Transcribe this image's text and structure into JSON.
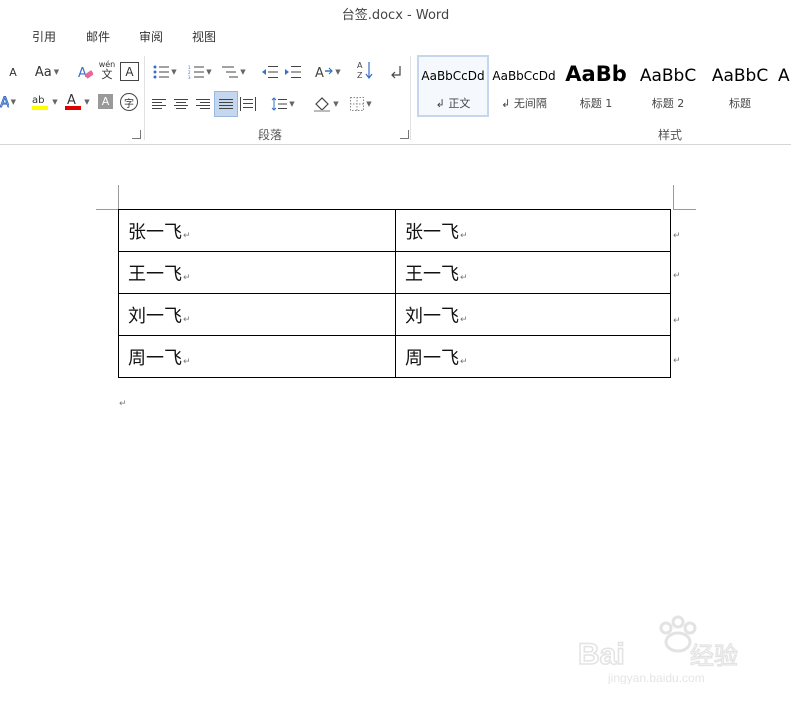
{
  "window": {
    "title": "台签.docx - Word"
  },
  "tabs": [
    {
      "label": "引用"
    },
    {
      "label": "邮件"
    },
    {
      "label": "审阅"
    },
    {
      "label": "视图"
    }
  ],
  "ribbon": {
    "partial_tab": "　",
    "groups": {
      "paragraph": "段落",
      "styles": "样式"
    },
    "font_controls": {
      "grow": "A",
      "case": "Aa",
      "phonetic_top": "wén",
      "phonetic_bottom": "文",
      "border_char": "A",
      "circle_char": "字"
    }
  },
  "styles": [
    {
      "sample": "AaBbCcDd",
      "name": "↲ 正文",
      "selected": true
    },
    {
      "sample": "AaBbCcDd",
      "name": "↲ 无间隔"
    },
    {
      "sample": "AaBb",
      "name": "标题 1"
    },
    {
      "sample": "AaBbC",
      "name": "标题 2"
    },
    {
      "sample": "AaBbC",
      "name": "标题"
    }
  ],
  "table": {
    "rows": [
      [
        "张一飞",
        "张一飞"
      ],
      [
        "王一飞",
        "王一飞"
      ],
      [
        "刘一飞",
        "刘一飞"
      ],
      [
        "周一飞",
        "周一飞"
      ]
    ],
    "paragraph_mark": "↵"
  },
  "colors": {
    "highlight": "#ffff00",
    "font_red": "#e00000",
    "selected_bg": "#c5d7ef"
  }
}
